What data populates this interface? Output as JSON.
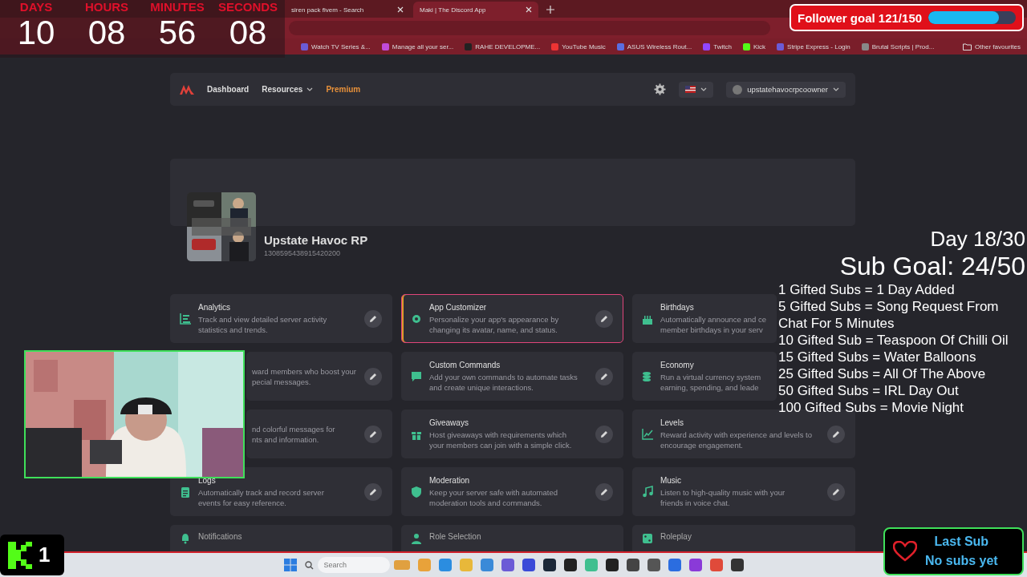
{
  "browser": {
    "tabs": [
      {
        "label": "siren pack fivem - Search",
        "selected": false
      },
      {
        "label": "Maki | The Discord App",
        "selected": true
      }
    ],
    "bookmarks": [
      "Watch TV Series &...",
      "Manage all your ser...",
      "RAHE DEVELOPME...",
      "YouTube Music",
      "ASUS Wireless Rout...",
      "Twitch",
      "Kick",
      "Stripe Express - Login",
      "Brutal Scripts | Prod..."
    ],
    "other_bookmarks": "Other favourites"
  },
  "countdown": [
    {
      "label": "DAYS",
      "value": "10"
    },
    {
      "label": "HOURS",
      "value": "08"
    },
    {
      "label": "MINUTES",
      "value": "56"
    },
    {
      "label": "SECONDS",
      "value": "08"
    }
  ],
  "follower_goal": {
    "label": "Follower goal 121/150",
    "level": 0.81
  },
  "nav": {
    "links": [
      {
        "label": "Dashboard",
        "kind": "link"
      },
      {
        "label": "Resources",
        "kind": "dropdown"
      },
      {
        "label": "Premium",
        "kind": "premium"
      }
    ],
    "user": "upstatehavocrpcoowner"
  },
  "server": {
    "name": "Upstate Havoc RP",
    "id": "1308595438915420200"
  },
  "modules": [
    {
      "kind": "full",
      "title": "Analytics",
      "description": "Track and view detailed server activity\nstatistics and trends.",
      "selected": false,
      "edit_button": true
    },
    {
      "kind": "full",
      "title": "App Customizer",
      "description": "Personalize your app's appearance by\nchanging its avatar, name, and status.",
      "selected": true,
      "edit_button": true
    },
    {
      "kind": "clipped",
      "title": "Birthdays",
      "description": "Automatically announce and ce\nmember birthdays in your serv",
      "selected": false,
      "edit_button": false
    },
    {
      "kind": "covered",
      "description": "ward members who boost your\npecial messages.",
      "selected": false,
      "edit_button": true
    },
    {
      "kind": "full",
      "title": "Custom Commands",
      "description": "Add your own commands to automate tasks\nand create unique interactions.",
      "selected": false,
      "edit_button": true
    },
    {
      "kind": "clipped",
      "title": "Economy",
      "description": "Run a virtual currency system\nearning, spending, and leade",
      "selected": false,
      "edit_button": false
    },
    {
      "kind": "covered",
      "description": "nd colorful messages for\nnts and information.",
      "selected": false,
      "edit_button": true
    },
    {
      "kind": "full",
      "title": "Giveaways",
      "description": "Host giveaways with requirements which\nyour members can join with a simple click.",
      "selected": false,
      "edit_button": true
    },
    {
      "kind": "full",
      "title": "Levels",
      "description": "Reward activity with experience and levels to\nencourage engagement.",
      "selected": false,
      "edit_button": true
    },
    {
      "kind": "full",
      "title": "Logs",
      "description": "Automatically track and record server\nevents for easy reference.",
      "selected": false,
      "edit_button": true
    },
    {
      "kind": "full",
      "title": "Moderation",
      "description": "Keep your server safe with automated\nmoderation tools and commands.",
      "selected": false,
      "edit_button": true
    },
    {
      "kind": "full",
      "title": "Music",
      "description": "Listen to high-quality music with your\nfriends in voice chat.",
      "selected": false,
      "edit_button": true
    },
    {
      "kind": "cut",
      "title": "Notifications",
      "selected": false,
      "edit_button": false
    },
    {
      "kind": "cut",
      "title": "Role Selection",
      "selected": false,
      "edit_button": false
    },
    {
      "kind": "cut",
      "title": "Roleplay",
      "selected": false,
      "edit_button": false
    }
  ],
  "sub_goal": {
    "day": "Day 18/30",
    "goal": "Sub Goal: 24/50",
    "rewards": [
      "1 Gifted Subs = 1 Day Added",
      "5 Gifted Subs =  Song Request From Chat For 5 Minutes",
      "10 Gifted Sub = Teaspoon Of Chilli Oil",
      "15 Gifted Subs = Water Balloons",
      "25 Gifted Subs = All Of The Above",
      "50 Gifted Subs = IRL Day Out",
      "100 Gifted Subs = Movie Night"
    ]
  },
  "kick_badge": {
    "count": "1"
  },
  "last_sub": {
    "title": "Last Sub",
    "value": "No subs yet"
  },
  "taskbar": {
    "search_placeholder": "Search"
  }
}
